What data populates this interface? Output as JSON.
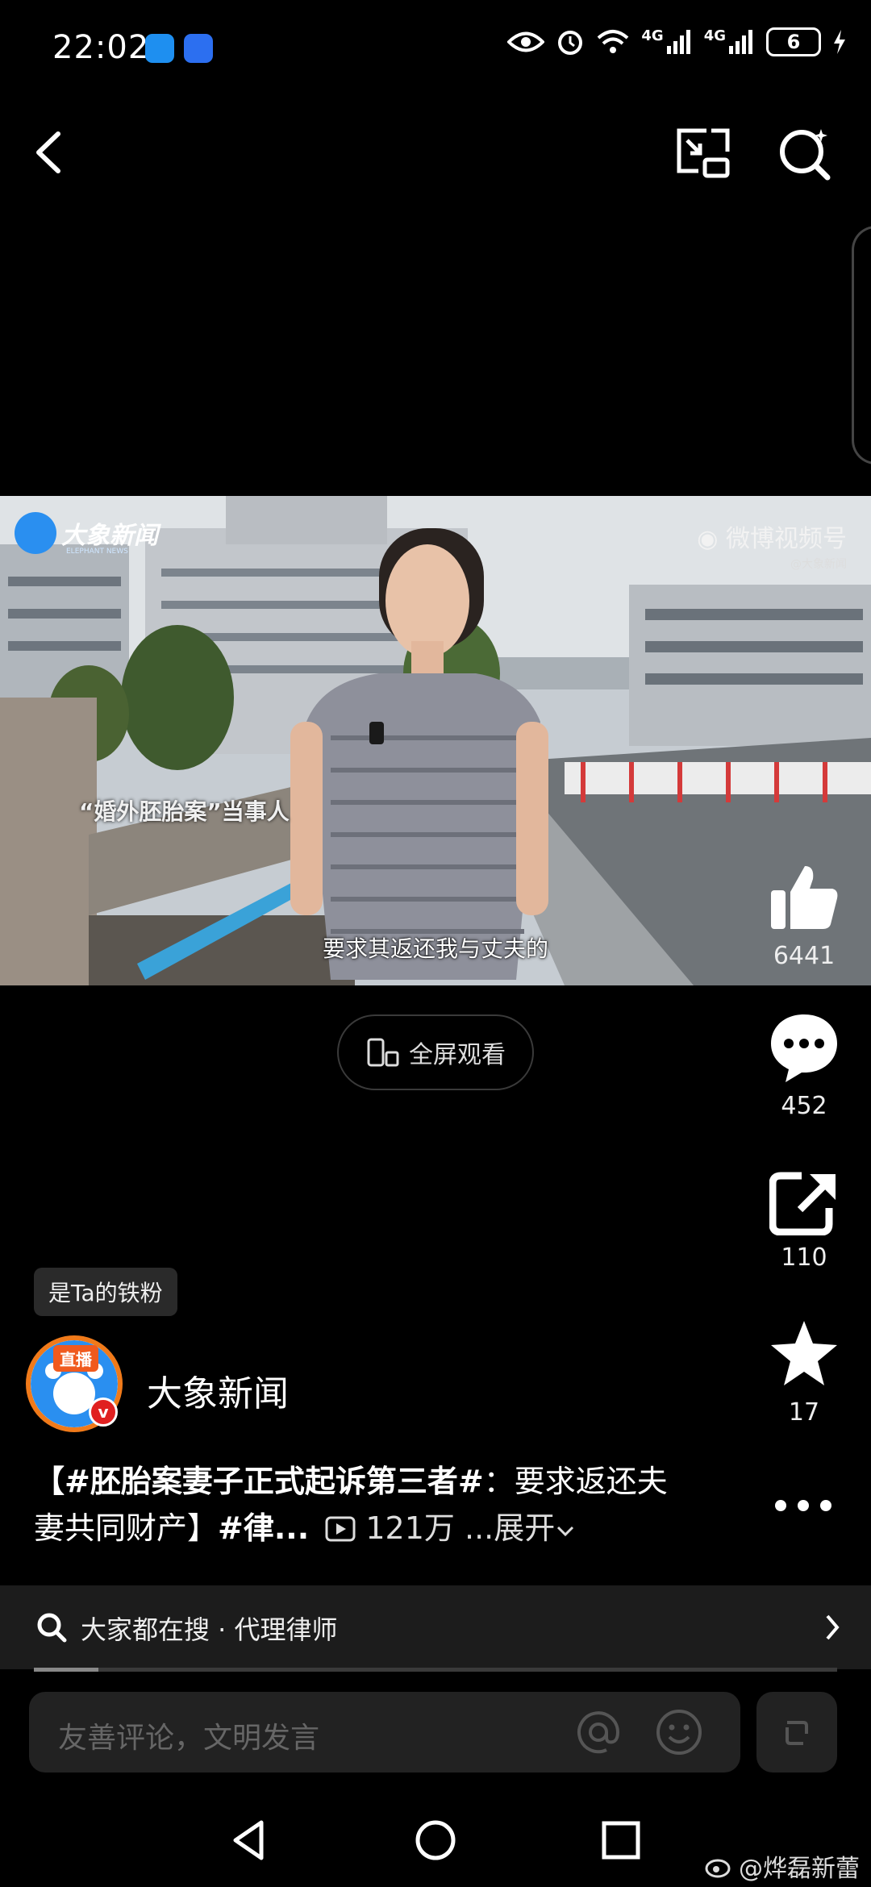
{
  "status_bar": {
    "time": "22:02",
    "battery": "6",
    "network_1": "4G",
    "network_2": "4G",
    "icons": [
      "chat-app-icon",
      "app-badge-icon",
      "eye-icon",
      "alarm-icon",
      "wifi-icon",
      "signal-icon",
      "signal-icon",
      "battery-icon",
      "charging-icon"
    ]
  },
  "top_bar": {
    "back_icon": "chevron-left-icon",
    "pip_icon": "picture-in-picture-icon",
    "search_icon": "search-sparkle-icon"
  },
  "video": {
    "logo_text": "大象新闻",
    "logo_sub": "ELEPHANT NEWS",
    "watermark": "微博视频号",
    "watermark_sub": "@大象新闻",
    "overlay_label": "“婚外胚胎案”当事人",
    "subtitle": "要求其返还我与丈夫的"
  },
  "fullscreen_label": "全屏观看",
  "actions": {
    "like_count": "6441",
    "comment_count": "452",
    "share_count": "110",
    "favorite_count": "17"
  },
  "fan_badge": "是Ta的铁粉",
  "author": {
    "live_tag": "直播",
    "verify": "v",
    "name": "大象新闻"
  },
  "description": {
    "part1": "【#胚胎案妻子正式起诉第三者#",
    "part2": "：要求返还夫妻共同财产】",
    "part3": "#律...",
    "views": "121万",
    "expand": "...展开"
  },
  "search": {
    "label": "大家都在搜 · 代理律师"
  },
  "progress": {
    "played_fraction": 0.08
  },
  "comment": {
    "placeholder": "友善评论，文明发言"
  },
  "watermark_user": "@烨磊新蕾",
  "colors": {
    "accent_orange": "#f07a1a",
    "verify_red": "#e02020",
    "background": "#000000"
  }
}
